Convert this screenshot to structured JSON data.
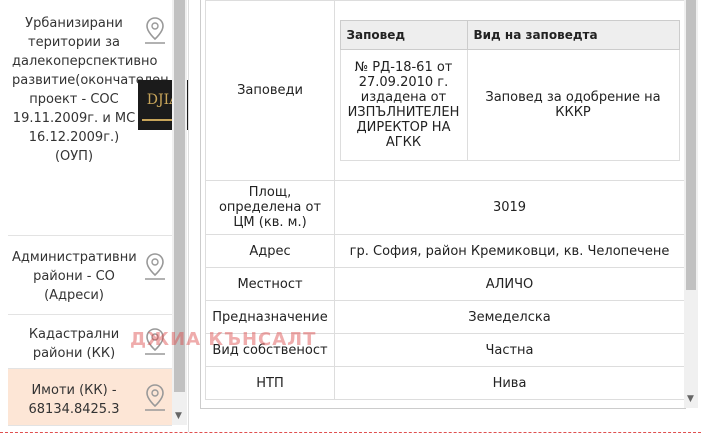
{
  "sidebar": {
    "items": [
      {
        "label": "Урбанизирани територии за далекоперспективно развитие(окончателен проект - СОС 19.11.2009г. и МС 16.12.2009г.) (ОУП)"
      },
      {
        "label": "Административни райони - СО (Адреси)"
      },
      {
        "label": "Кадастрални райони (КК)"
      },
      {
        "label": "Имоти (КК) - 68134.8425.3"
      }
    ],
    "logo_text": "DJIA"
  },
  "orders": {
    "row_label": "Заповеди",
    "headers": [
      "Заповед",
      "Вид на заповедта"
    ],
    "rows": [
      {
        "order": "№ РД-18-61 от 27.09.2010 г. издадена от ИЗПЪЛНИТЕЛЕН ДИРЕКТОР НА АГКК",
        "type": "Заповед за одобрение на КККР"
      }
    ]
  },
  "attributes": [
    {
      "key": "Площ, определена от ЦМ (кв. м.)",
      "value": "3019"
    },
    {
      "key": "Адрес",
      "value": "гр. София, район Кремиковци, кв. Челопечене"
    },
    {
      "key": "Местност",
      "value": "АЛИЧО"
    },
    {
      "key": "Предназначение",
      "value": "Земеделска"
    },
    {
      "key": "Вид собственост",
      "value": "Частна"
    },
    {
      "key": "НТП",
      "value": "Нива"
    }
  ],
  "watermark": "ДЖИА КЪНСАЛТ"
}
